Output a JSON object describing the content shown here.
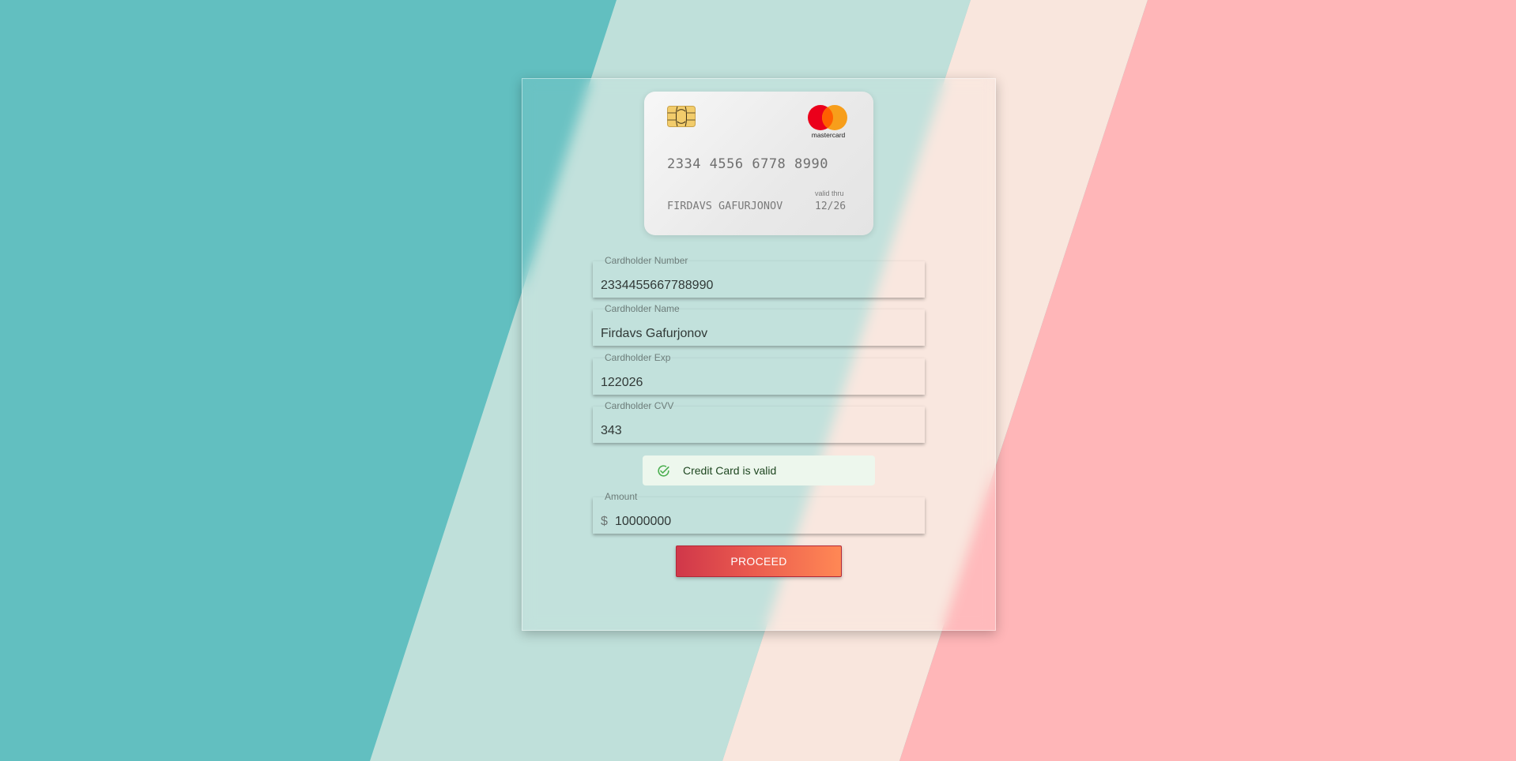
{
  "colors": {
    "teal": "#62bfc0",
    "mint": "#bfe0da",
    "peach": "#f9e6dd",
    "pink": "#ffb6b8",
    "success_bg": "#edf7ed",
    "success_icon": "#4caf50",
    "proceed_start": "#d0374a",
    "proceed_end": "#ff8855"
  },
  "card": {
    "brand": "mastercard",
    "number": "2334 4556 6778 8990",
    "holder": "FIRDAVS GAFURJONOV",
    "valid_thru_label": "valid thru",
    "expiry": "12/26",
    "chip_icon": "chip-icon",
    "logo_icon": "mastercard-logo-icon"
  },
  "form": {
    "number": {
      "label": "Cardholder Number",
      "value": "2334455667788990"
    },
    "name": {
      "label": "Cardholder Name",
      "value": "Firdavs Gafurjonov"
    },
    "exp": {
      "label": "Cardholder Exp",
      "value": "122026"
    },
    "cvv": {
      "label": "Cardholder CVV",
      "value": "343"
    },
    "amount": {
      "label": "Amount",
      "currency": "$",
      "value": "10000000"
    }
  },
  "alert": {
    "icon": "check-circle-icon",
    "message": "Credit Card is valid"
  },
  "actions": {
    "proceed_label": "PROCEED"
  }
}
